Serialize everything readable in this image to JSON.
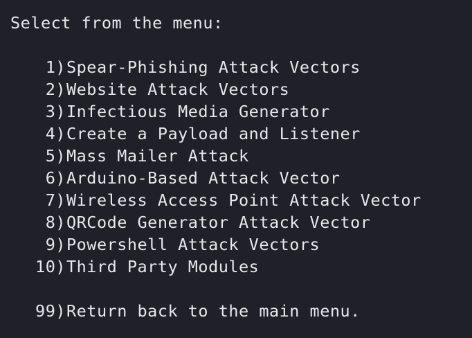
{
  "terminal": {
    "prompt": "Select from the menu:",
    "items": [
      {
        "num": "1)",
        "label": "Spear-Phishing Attack Vectors"
      },
      {
        "num": "2)",
        "label": "Website Attack Vectors"
      },
      {
        "num": "3)",
        "label": "Infectious Media Generator"
      },
      {
        "num": "4)",
        "label": "Create a Payload and Listener"
      },
      {
        "num": "5)",
        "label": "Mass Mailer Attack"
      },
      {
        "num": "6)",
        "label": "Arduino-Based Attack Vector"
      },
      {
        "num": "7)",
        "label": "Wireless Access Point Attack Vector"
      },
      {
        "num": "8)",
        "label": "QRCode Generator Attack Vector"
      },
      {
        "num": "9)",
        "label": "Powershell Attack Vectors"
      },
      {
        "num": "10)",
        "label": "Third Party Modules"
      }
    ],
    "return_item": {
      "num": "99)",
      "label": "Return back to the main menu."
    }
  },
  "colors": {
    "background": "#1f2028",
    "text": "#e8e8ea"
  }
}
